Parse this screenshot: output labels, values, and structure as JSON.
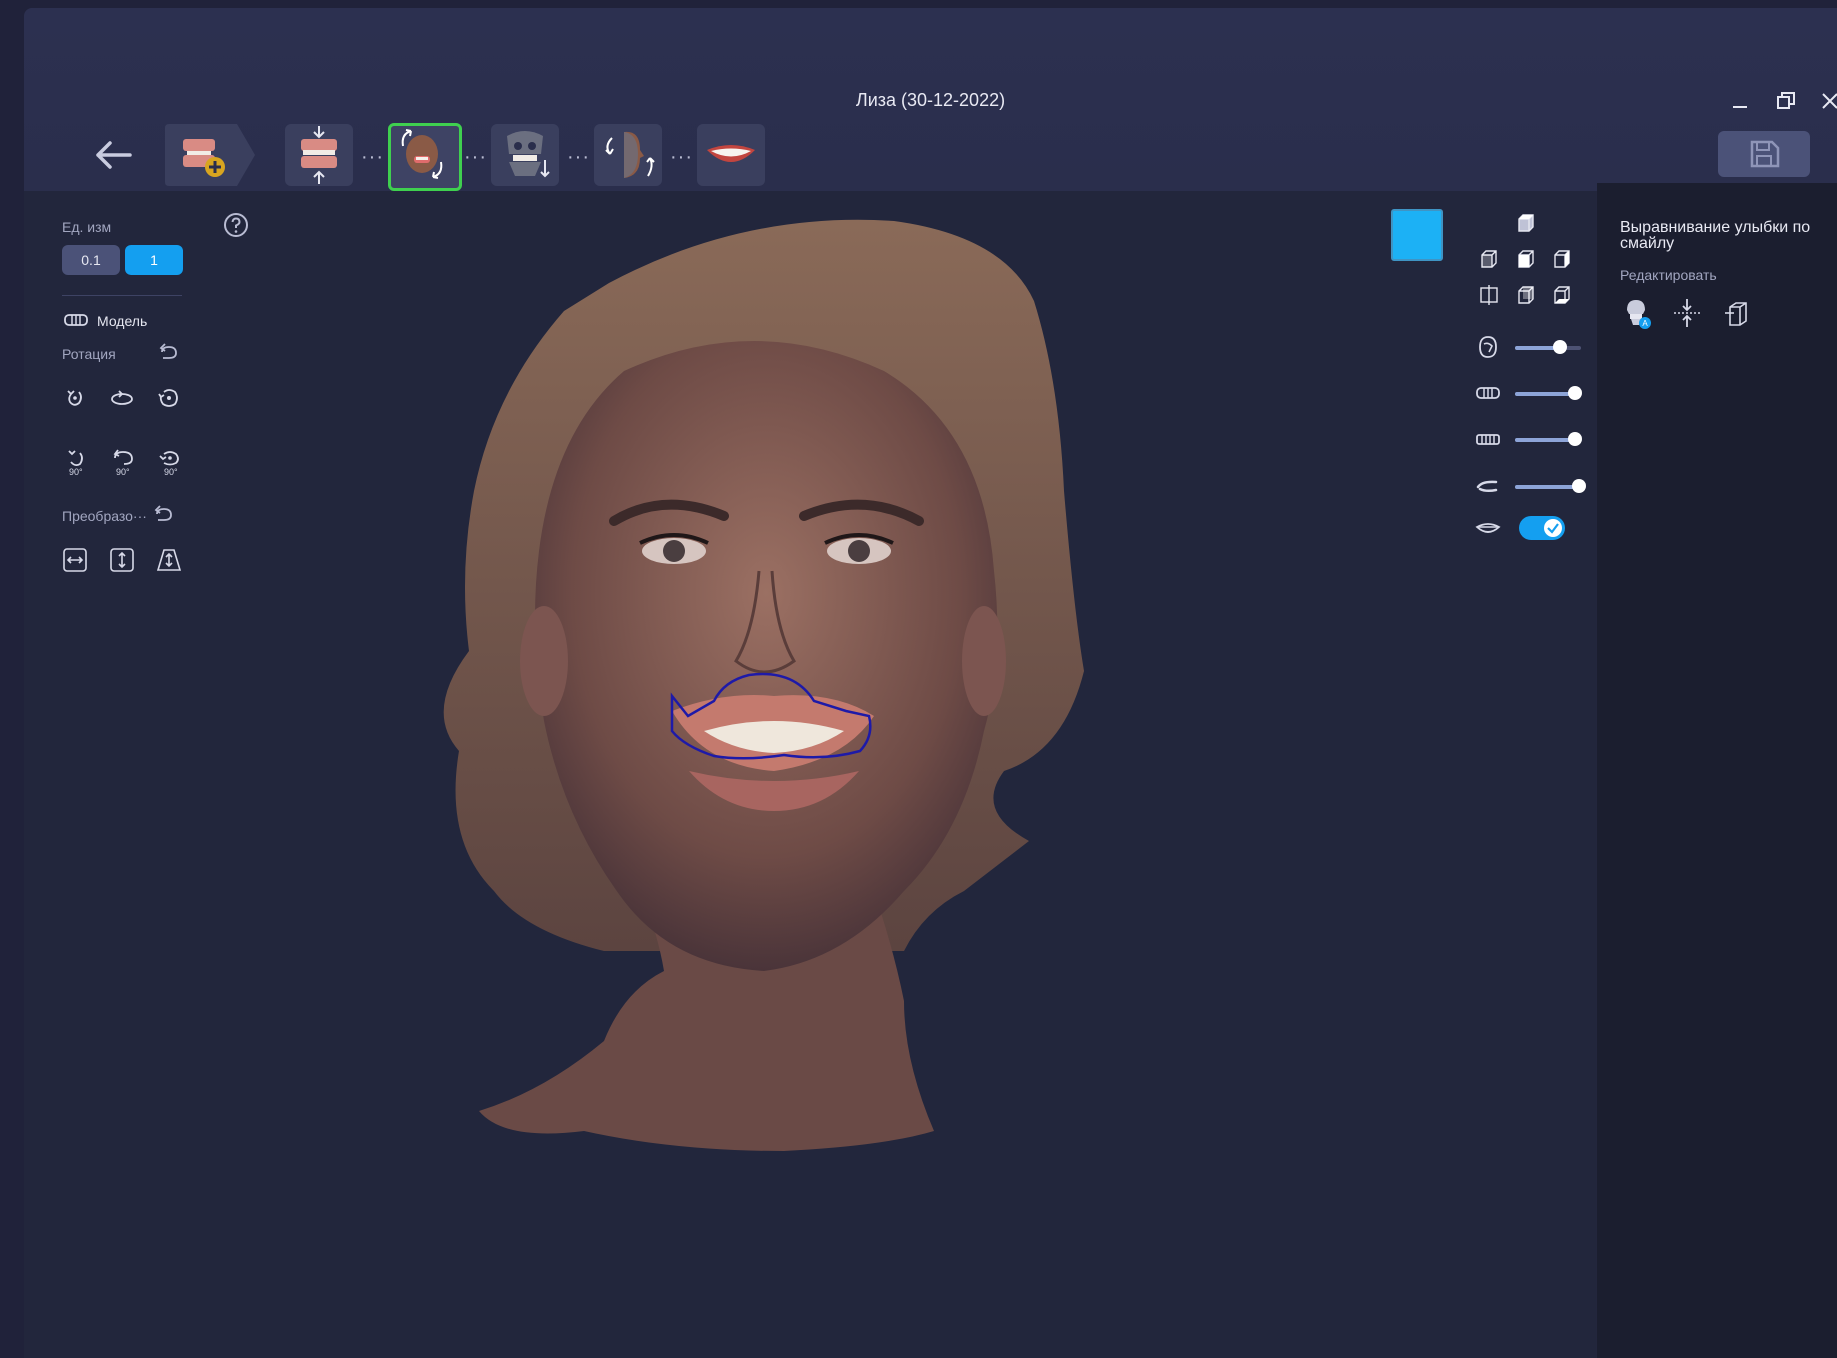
{
  "window": {
    "title": "Лиза (30-12-2022)"
  },
  "workflow_steps": [
    {
      "icon": "add-model-icon",
      "label": ""
    },
    {
      "icon": "bite-alignment-icon",
      "label": ""
    },
    {
      "icon": "smile-alignment-icon",
      "label": "",
      "active": true
    },
    {
      "icon": "skull-jaw-icon",
      "label": ""
    },
    {
      "icon": "face-profile-rotate-icon",
      "label": ""
    },
    {
      "icon": "smile-lips-icon",
      "label": ""
    }
  ],
  "left_panel": {
    "units_label": "Ед. изм",
    "unit_options": [
      "0.1",
      "1"
    ],
    "unit_selected": "1",
    "model_label": "Модель",
    "rotation_label": "Ротация",
    "rotation_90_label": "90°",
    "transform_label": "Преобразо···"
  },
  "right_panel": {
    "title": "Выравнивание улыбки по смайлу",
    "edit_label": "Редактировать"
  },
  "view_controls": {
    "swatch_color": "#1cb1f5",
    "sliders": [
      {
        "name": "face-opacity",
        "value": 0.6
      },
      {
        "name": "upper-jaw-opacity",
        "value": 0.9
      },
      {
        "name": "lower-jaw-opacity",
        "value": 0.9
      },
      {
        "name": "lip-line-opacity",
        "value": 1.0
      }
    ],
    "lips_toggle": true
  }
}
